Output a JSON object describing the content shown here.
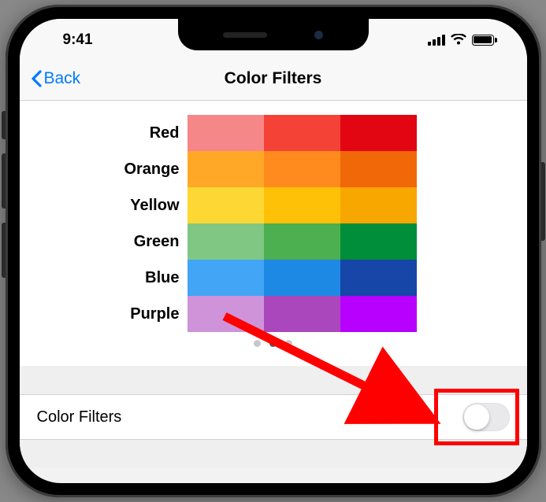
{
  "status": {
    "time": "9:41"
  },
  "nav": {
    "back_label": "Back",
    "title": "Color Filters"
  },
  "color_grid": {
    "rows": [
      {
        "label": "Red",
        "swatches": [
          "#f68789",
          "#f44336",
          "#e20612"
        ]
      },
      {
        "label": "Orange",
        "swatches": [
          "#ffa726",
          "#ff8a1e",
          "#f16808"
        ]
      },
      {
        "label": "Yellow",
        "swatches": [
          "#fdd835",
          "#ffc107",
          "#f8a600"
        ]
      },
      {
        "label": "Green",
        "swatches": [
          "#81c784",
          "#4caf50",
          "#008e3a"
        ]
      },
      {
        "label": "Blue",
        "swatches": [
          "#42a5f5",
          "#1e88e5",
          "#1646a8"
        ]
      },
      {
        "label": "Purple",
        "swatches": [
          "#ce93d8",
          "#ab47bc",
          "#b700ff"
        ]
      }
    ]
  },
  "pagination": {
    "count": 3,
    "active_index": 1
  },
  "toggle_row": {
    "label": "Color Filters",
    "enabled": false
  },
  "annotation": {
    "highlight": "toggle-switch"
  }
}
